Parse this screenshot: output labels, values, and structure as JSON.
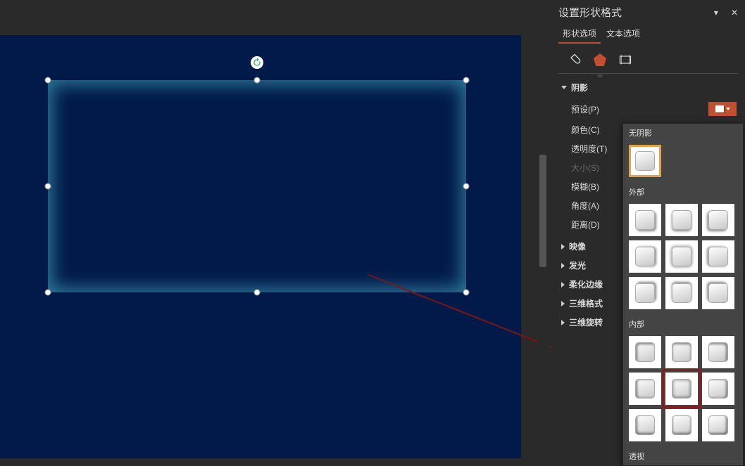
{
  "pane": {
    "title": "设置形状格式",
    "tabs": {
      "shape_options": "形状选项",
      "text_options": "文本选项"
    },
    "sections": {
      "shadow": "阴影",
      "reflection": "映像",
      "glow": "发光",
      "soft_edges": "柔化边缘",
      "threeDFormat": "三维格式",
      "threeDRotation": "三维旋转"
    },
    "shadow_props": {
      "preset": "预设(P)",
      "color": "颜色(C)",
      "transparency": "透明度(T)",
      "size": "大小(S)",
      "blur": "模糊(B)",
      "angle": "角度(A)",
      "distance": "距离(D)"
    },
    "shadow_popup": {
      "none": "无阴影",
      "outer": "外部",
      "inner": "内部",
      "perspective_cut": "透视"
    }
  }
}
